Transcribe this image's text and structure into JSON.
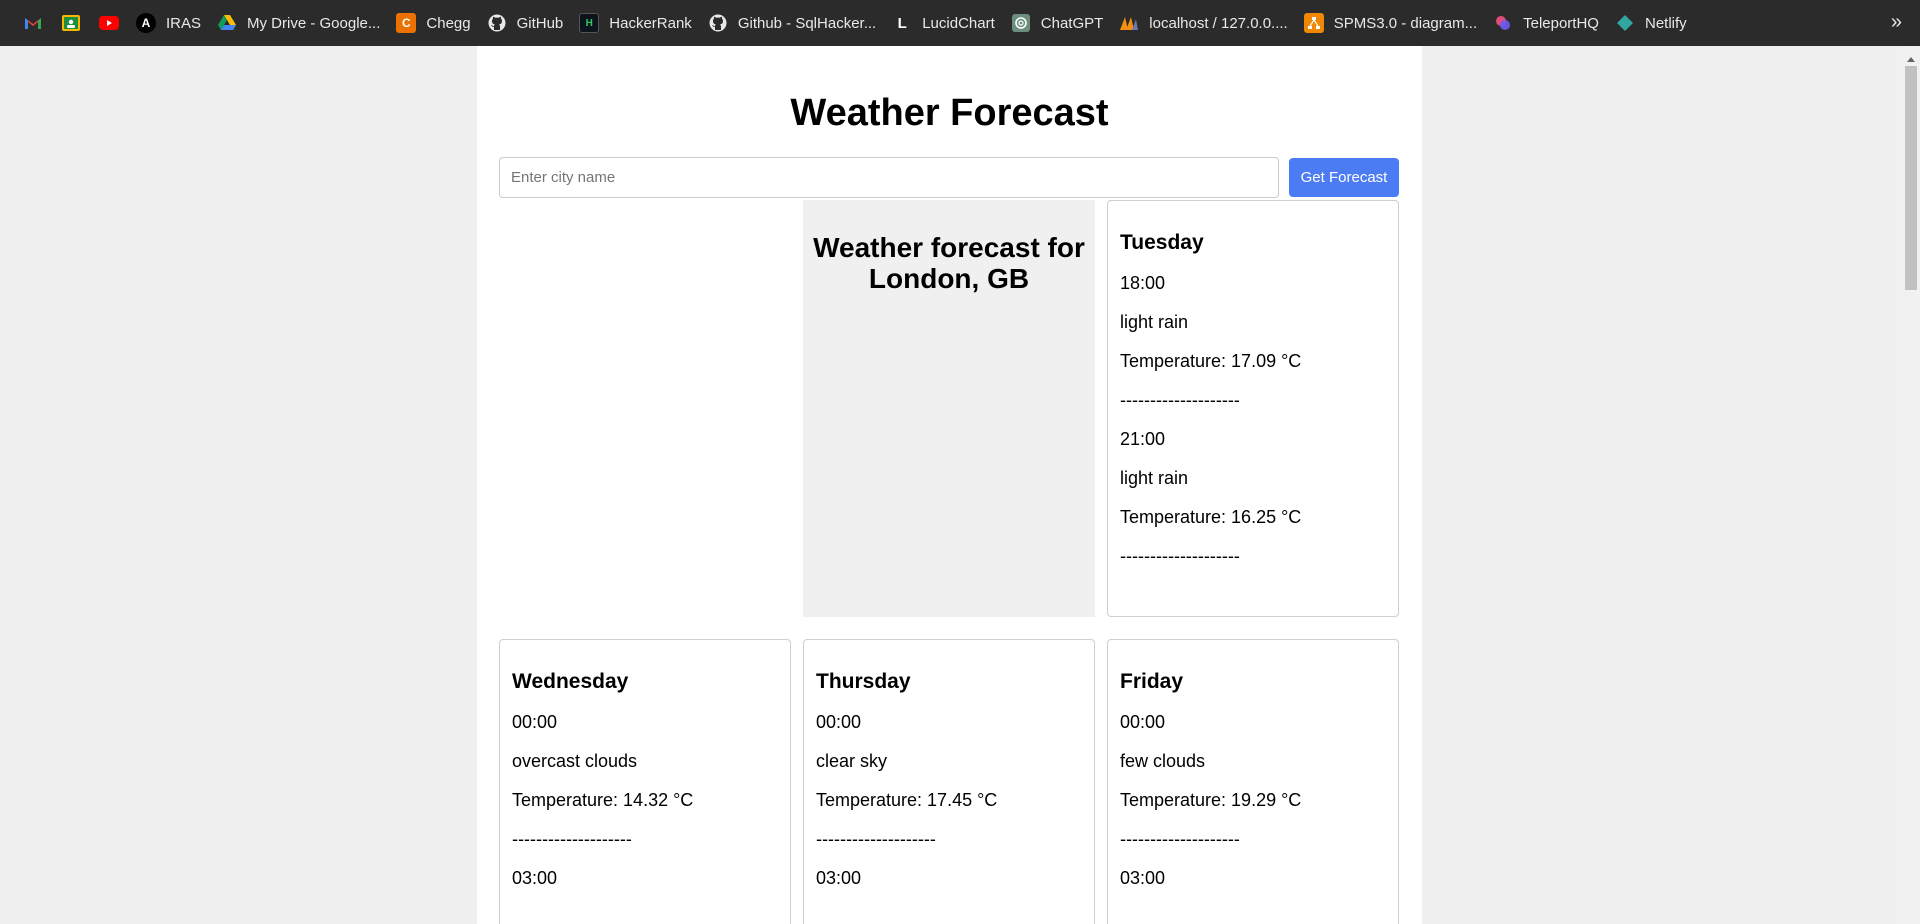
{
  "bookmarks": {
    "items": [
      {
        "label": "",
        "icon": "gmail-icon"
      },
      {
        "label": "",
        "icon": "classroom-icon"
      },
      {
        "label": "",
        "icon": "youtube-icon"
      },
      {
        "label": "IRAS",
        "icon": "iras-icon"
      },
      {
        "label": "My Drive - Google...",
        "icon": "drive-icon"
      },
      {
        "label": "Chegg",
        "icon": "chegg-icon"
      },
      {
        "label": "GitHub",
        "icon": "github-icon"
      },
      {
        "label": "HackerRank",
        "icon": "hackerrank-icon"
      },
      {
        "label": "Github - SqlHacker...",
        "icon": "github-icon"
      },
      {
        "label": "LucidChart",
        "icon": "lucidchart-icon"
      },
      {
        "label": "ChatGPT",
        "icon": "chatgpt-icon"
      },
      {
        "label": "localhost / 127.0.0....",
        "icon": "phpmyadmin-icon"
      },
      {
        "label": "SPMS3.0 - diagram...",
        "icon": "drawio-icon"
      },
      {
        "label": "TeleportHQ",
        "icon": "teleporthq-icon"
      },
      {
        "label": "Netlify",
        "icon": "netlify-icon"
      }
    ],
    "overflow": "»"
  },
  "page": {
    "title": "Weather Forecast",
    "search_placeholder": "Enter city name",
    "search_value": "",
    "button_label": "Get Forecast",
    "forecast_heading": "Weather forecast for London, GB"
  },
  "days": {
    "tuesday": {
      "name": "Tuesday",
      "lines": [
        "18:00",
        "light rain",
        "Temperature: 17.09 °C",
        "--------------------",
        "21:00",
        "light rain",
        "Temperature: 16.25 °C",
        "--------------------"
      ]
    },
    "wednesday": {
      "name": "Wednesday",
      "lines": [
        "00:00",
        "overcast clouds",
        "Temperature: 14.32 °C",
        "--------------------",
        "03:00"
      ]
    },
    "thursday": {
      "name": "Thursday",
      "lines": [
        "00:00",
        "clear sky",
        "Temperature: 17.45 °C",
        "--------------------",
        "03:00"
      ]
    },
    "friday": {
      "name": "Friday",
      "lines": [
        "00:00",
        "few clouds",
        "Temperature: 19.29 °C",
        "--------------------",
        "03:00"
      ]
    }
  },
  "colors": {
    "button": "#4c7cf3",
    "bookmarks_bar": "#2b2b2b",
    "page_bg": "#f0f0f0"
  }
}
